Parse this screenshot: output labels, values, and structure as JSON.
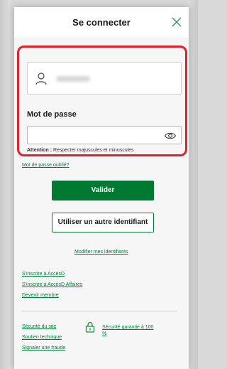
{
  "header": {
    "title": "Se connecter"
  },
  "login": {
    "password_label": "Mot de passe",
    "attention_prefix": "Attention :",
    "attention_text": " Respecter majuscules et minuscules",
    "forgot_link": "Mot de passe oublié?"
  },
  "actions": {
    "validate_label": "Valider",
    "other_id_label": "Utiliser un autre identifiant",
    "modify_link": "Modifier mes identifiants"
  },
  "register": {
    "items": [
      "S'inscrire à AccèsD",
      "S'inscrire à AccèsD Affaires",
      "Devenir membre"
    ]
  },
  "footer": {
    "links": [
      "Sécurité du site",
      "Soutien technique",
      "Signaler une fraude"
    ],
    "guarantee": "Sécurité garantie à 100 %"
  },
  "colors": {
    "brand_green": "#007a33",
    "highlight_red": "#e0222b"
  },
  "icons": [
    "user-icon",
    "eye-icon",
    "close-icon",
    "lock-icon"
  ]
}
